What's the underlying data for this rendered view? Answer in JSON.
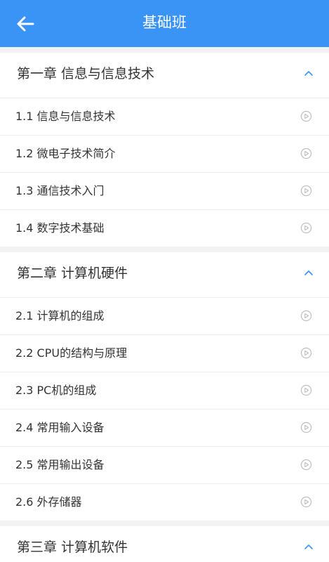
{
  "header": {
    "title": "基础班",
    "back_icon": "arrow-left-icon",
    "background_color": "#3a94f5"
  },
  "chapters": [
    {
      "title": "第一章 信息与信息技术",
      "expanded": true,
      "lessons": [
        {
          "title": "1.1 信息与信息技术"
        },
        {
          "title": "1.2  微电子技术简介"
        },
        {
          "title": "1.3  通信技术入门"
        },
        {
          "title": "1.4  数字技术基础"
        }
      ]
    },
    {
      "title": "第二章 计算机硬件",
      "expanded": true,
      "lessons": [
        {
          "title": "2.1 计算机的组成"
        },
        {
          "title": "2.2 CPU的结构与原理"
        },
        {
          "title": "2.3  PC机的组成"
        },
        {
          "title": "2.4  常用输入设备"
        },
        {
          "title": "2.5  常用输出设备"
        },
        {
          "title": "2.6   外存储器"
        }
      ]
    },
    {
      "title": "第三章 计算机软件",
      "expanded": true,
      "lessons": []
    }
  ],
  "icons": {
    "chapter_toggle": "chevron-up-icon",
    "lesson_action": "play-circle-icon"
  },
  "colors": {
    "accent": "#3a94f5",
    "chevron": "#3a94f5",
    "play_icon": "#bbbbbb"
  }
}
